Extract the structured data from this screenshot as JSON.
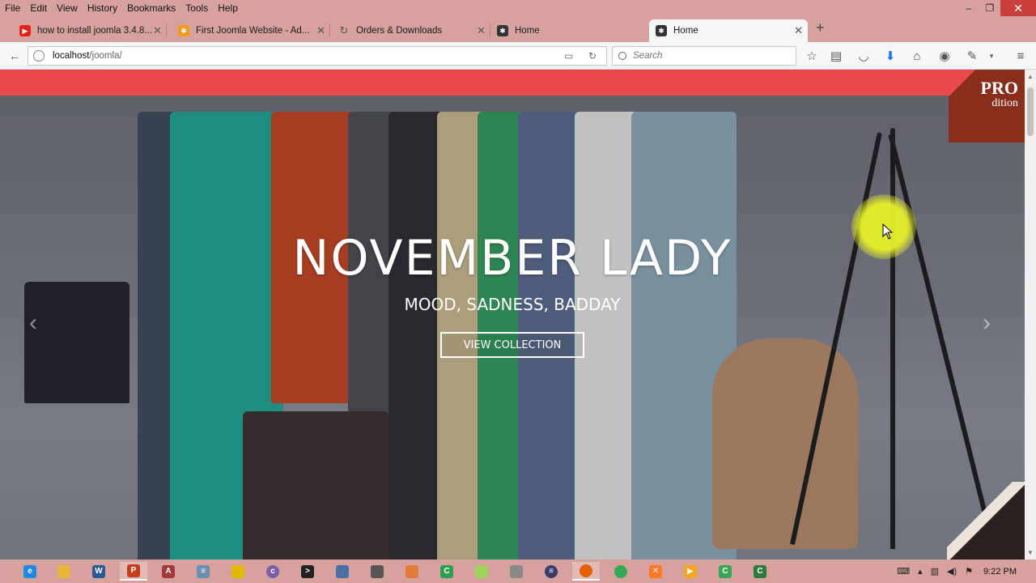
{
  "menu": [
    "File",
    "Edit",
    "View",
    "History",
    "Bookmarks",
    "Tools",
    "Help"
  ],
  "window_controls": {
    "minimize": "–",
    "restore": "❐",
    "close": "✕"
  },
  "tabs": [
    {
      "label": "how to install joomla 3.4.8...",
      "icon": "youtube-icon",
      "color": "#e62117"
    },
    {
      "label": "First Joomla Website - Ad...",
      "icon": "joomla-icon",
      "color": "#f09a1e"
    },
    {
      "label": "Orders & Downloads",
      "icon": "sync-icon",
      "color": "#555555"
    },
    {
      "label": "Home",
      "icon": "joomla-icon",
      "color": "#333333"
    },
    {
      "label": "Home",
      "icon": "joomla-icon",
      "color": "#333333",
      "active": true
    }
  ],
  "url": {
    "host": "localhost",
    "path": "/joomla/"
  },
  "search": {
    "placeholder": "Search"
  },
  "hero": {
    "title": "NOVEMBER LADY",
    "subtitle": "MOOD, SADNESS, BADDAY",
    "button": "VIEW COLLECTION",
    "prev": "‹",
    "next": "›"
  },
  "badge": {
    "line1": "PRO",
    "line2": "dition"
  },
  "colors": {
    "accent_bar": "#e84a49",
    "chrome": "#d7a29e"
  },
  "taskbar": {
    "clock": "9:22 PM"
  }
}
